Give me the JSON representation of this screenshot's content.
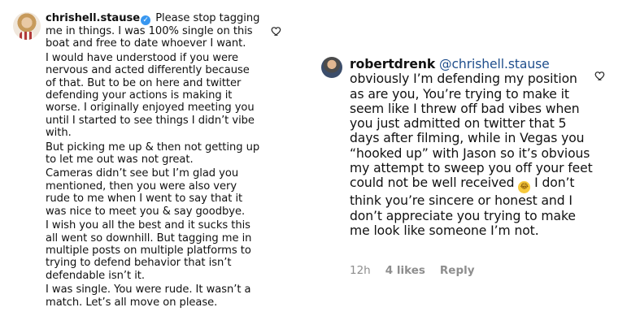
{
  "comment_1": {
    "username": "chrishell.stause",
    "paragraphs": [
      "Please stop tagging me in things. I was 100% single on this boat and free to date whoever I want.",
      "I would have understood if you were nervous and acted differently because of that. But to be on here and twitter defending your actions is making it worse. I originally enjoyed meeting you until I started to see things I didn’t vibe with.",
      "But picking me up & then not getting up to let me out was not great.",
      "Cameras didn’t see but I’m glad you mentioned, then you were also very rude to me when I went to say that it was nice to meet you & say goodbye.",
      "I wish you all the best and it sucks this all went so downhill. But tagging me in multiple posts on multiple platforms to trying to defend behavior that isn’t defendable isn’t it.",
      "I was single. You were rude. It wasn’t a match. Let’s all move on please."
    ]
  },
  "comment_2": {
    "username": "robertdrenk",
    "mention": "@chrishell.stause",
    "text_before_emoji": "obviously I’m defending my position as are you, You’re trying to make it seem like I threw off bad vibes when you just admitted on twitter that 5 days after filming, while in Vegas you “hooked up” with Jason so it’s obvious my attempt to sweep you off your feet could not be well received",
    "emoji": "😂",
    "text_after_emoji": " I don’t think you’re sincere or honest and I don’t appreciate you trying to make me look like someone I’m not.",
    "time": "12h",
    "likes": "4 likes",
    "reply": "Reply"
  },
  "icons": {
    "verified": "verified-badge-icon",
    "like": "heart-outline-icon"
  },
  "colors": {
    "verified": "#3897f0",
    "mention": "#1f4e8c",
    "meta": "#8e8e8e"
  }
}
